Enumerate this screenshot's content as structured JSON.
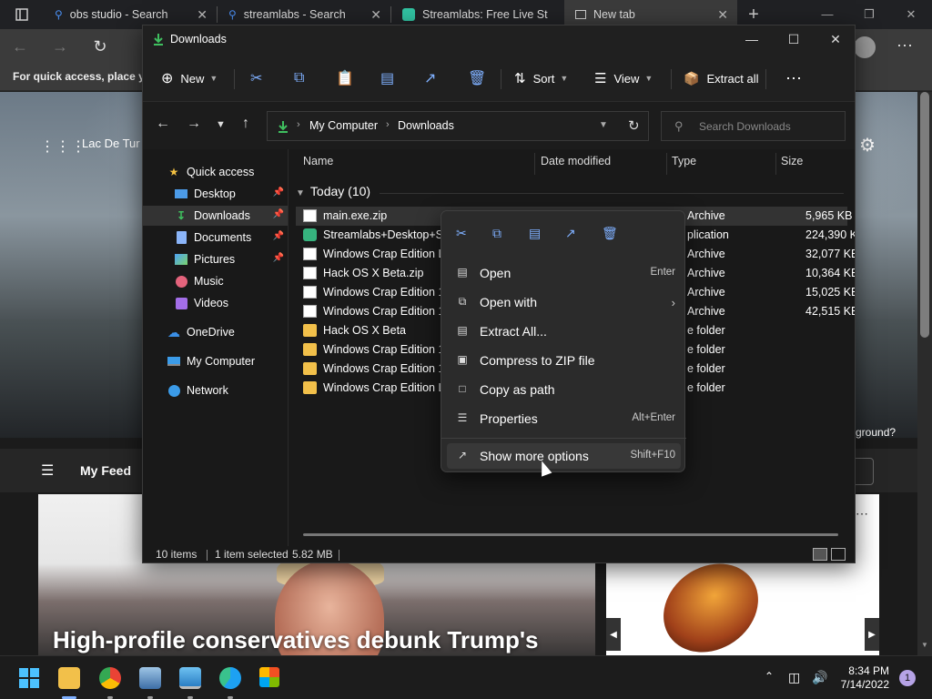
{
  "browser": {
    "tabs": [
      {
        "title": "obs studio - Search"
      },
      {
        "title": "streamlabs - Search"
      },
      {
        "title": "Streamlabs: Free Live St"
      },
      {
        "title": "New tab"
      }
    ],
    "favbar_text": "For quick access, place yo",
    "ntp": {
      "location_text": "Lac De Tur",
      "background_question": "ground?",
      "feed_label": "My Feed",
      "headline": "High-profile conservatives debunk Trump's"
    }
  },
  "explorer": {
    "title": "Downloads",
    "toolbar": {
      "new": "New",
      "sort": "Sort",
      "view": "View",
      "extract_all": "Extract all"
    },
    "address": {
      "crumbs": [
        "My Computer",
        "Downloads"
      ]
    },
    "search_placeholder": "Search Downloads",
    "sidebar": [
      {
        "label": "Quick access",
        "icon": "star-icon",
        "pinned": false
      },
      {
        "label": "Desktop",
        "icon": "desktop-icon",
        "pinned": true
      },
      {
        "label": "Downloads",
        "icon": "download-icon",
        "pinned": true,
        "selected": true
      },
      {
        "label": "Documents",
        "icon": "documents-icon",
        "pinned": true
      },
      {
        "label": "Pictures",
        "icon": "pictures-icon",
        "pinned": true
      },
      {
        "label": "Music",
        "icon": "music-icon",
        "pinned": false
      },
      {
        "label": "Videos",
        "icon": "videos-icon",
        "pinned": false
      },
      {
        "label": "OneDrive",
        "icon": "cloud-icon",
        "pinned": false
      },
      {
        "label": "My Computer",
        "icon": "computer-icon",
        "pinned": false
      },
      {
        "label": "Network",
        "icon": "network-icon",
        "pinned": false
      }
    ],
    "columns": {
      "name": "Name",
      "date": "Date modified",
      "type": "Type",
      "size": "Size"
    },
    "group_label": "Today (10)",
    "files": [
      {
        "name": "main.exe.zip",
        "type": "Archive",
        "size": "5,965 KB",
        "kind": "zip",
        "selected": true
      },
      {
        "name": "Streamlabs+Desktop+Se",
        "type": "plication",
        "size": "224,390 KB",
        "kind": "app"
      },
      {
        "name": "Windows Crap Edition Le",
        "type": "Archive",
        "size": "32,077 KB",
        "kind": "zip"
      },
      {
        "name": "Hack OS X Beta.zip",
        "type": "Archive",
        "size": "10,364 KB",
        "kind": "zip"
      },
      {
        "name": "Windows Crap Edition 11",
        "type": "Archive",
        "size": "15,025 KB",
        "kind": "zip"
      },
      {
        "name": "Windows Crap Edition 12",
        "type": "Archive",
        "size": "42,515 KB",
        "kind": "zip"
      },
      {
        "name": "Hack OS X Beta",
        "type": "e folder",
        "size": "",
        "kind": "folder"
      },
      {
        "name": "Windows Crap Edition 11",
        "type": "e folder",
        "size": "",
        "kind": "folder"
      },
      {
        "name": "Windows Crap Edition 12",
        "type": "e folder",
        "size": "",
        "kind": "folder"
      },
      {
        "name": "Windows Crap Edition Le",
        "type": "e folder",
        "size": "",
        "kind": "folder"
      }
    ],
    "status": {
      "count": "10 items",
      "selected": "1 item selected",
      "size": "5.82 MB"
    }
  },
  "context_menu": {
    "items": [
      {
        "label": "Open",
        "shortcut": "Enter",
        "icon": "zip-open-icon"
      },
      {
        "label": "Open with",
        "shortcut": "",
        "icon": "open-with-icon",
        "submenu": true
      },
      {
        "label": "Extract All...",
        "shortcut": "",
        "icon": "extract-icon"
      },
      {
        "label": "Compress to ZIP file",
        "shortcut": "",
        "icon": "compress-icon"
      },
      {
        "label": "Copy as path",
        "shortcut": "",
        "icon": "copy-path-icon"
      },
      {
        "label": "Properties",
        "shortcut": "Alt+Enter",
        "icon": "properties-icon"
      },
      {
        "label": "Show more options",
        "shortcut": "Shift+F10",
        "icon": "more-options-icon",
        "hover": true
      }
    ]
  },
  "taskbar": {
    "time": "8:34 PM",
    "date": "7/14/2022",
    "notifications": "1"
  },
  "colors": {
    "accent": "#7fb0ff",
    "folder": "#f2c04a"
  }
}
